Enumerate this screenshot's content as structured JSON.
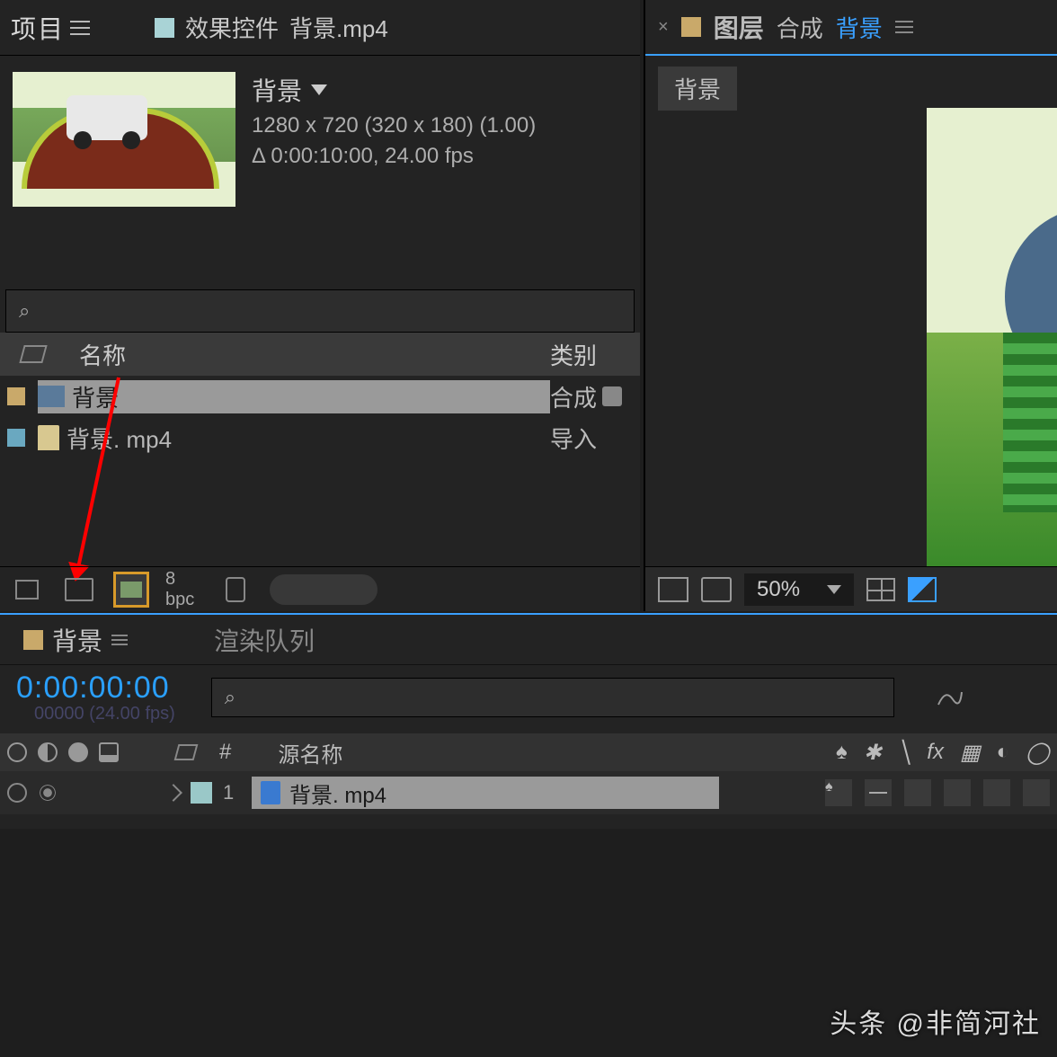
{
  "project": {
    "tab_project": "项目",
    "tab_effect_controls": "效果控件",
    "effect_target": "背景.mp4",
    "asset_title": "背景",
    "resolution": "1280 x 720  (320 x 180) (1.00)",
    "duration": "Δ 0:00:10:00, 24.00 fps",
    "search_icon": "⌕",
    "header_name": "名称",
    "header_type": "类别",
    "rows": [
      {
        "name": "背景",
        "type": "合成"
      },
      {
        "name": "背景. mp4",
        "type": "导入"
      }
    ],
    "bpc": "8 bpc"
  },
  "preview": {
    "tab_layer": "图层",
    "tab_composition": "合成",
    "tab_active": "背景",
    "sub_tab": "背景",
    "zoom": "50%"
  },
  "timeline": {
    "tab_comp": "背景",
    "tab_render": "渲染队列",
    "timecode": "0:00:00:00",
    "timecode_sub": "00000 (24.00 fps)",
    "search_icon": "⌕",
    "col_source": "源名称",
    "layer": {
      "index": "1",
      "name": "背景. mp4"
    }
  },
  "watermark": "头条 @非简河社"
}
